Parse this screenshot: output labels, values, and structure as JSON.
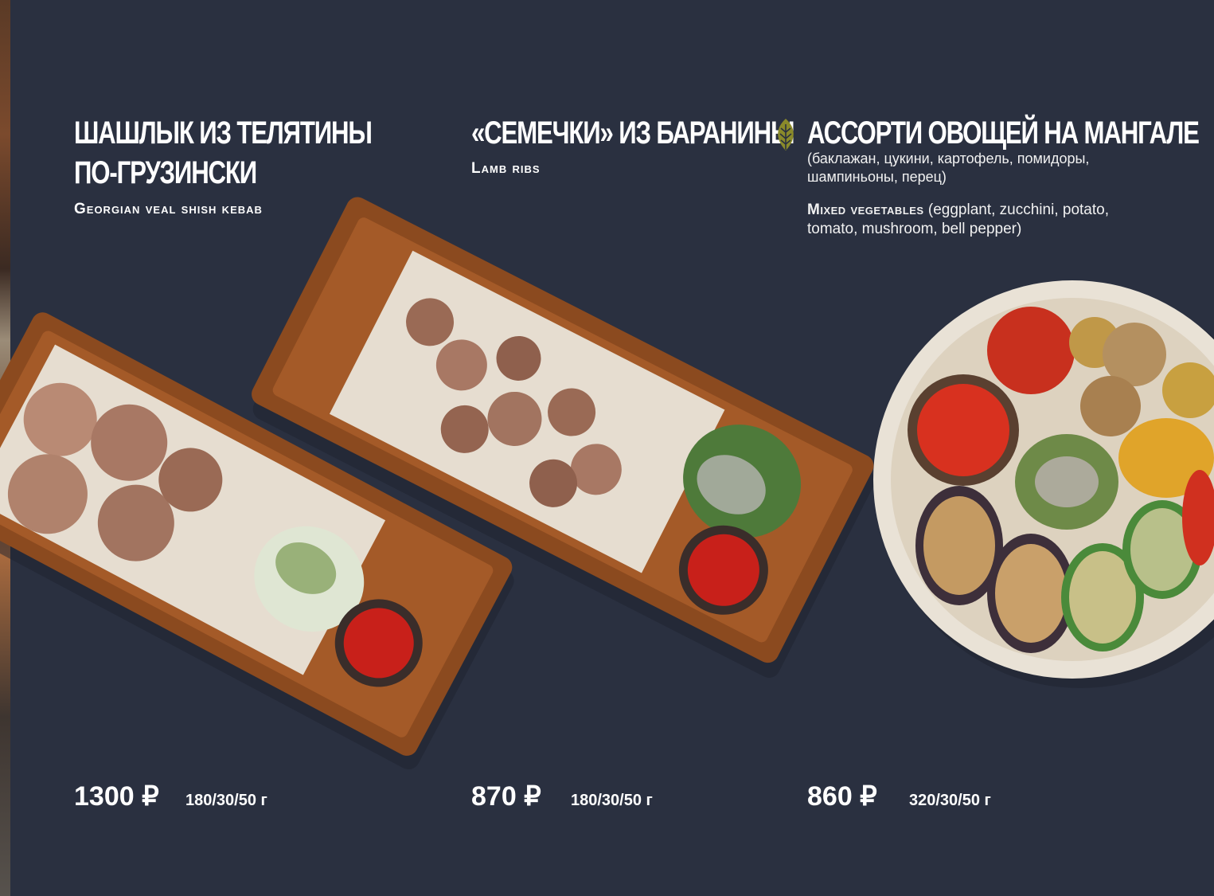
{
  "items": [
    {
      "title_line1": "ШАШЛЫК ИЗ ТЕЛЯТИНЫ",
      "title_line2": "ПО-ГРУЗИНСКИ",
      "name_en": "Georgian veal shish kebab",
      "price": "1300 ₽",
      "weight": "180/30/50 г"
    },
    {
      "title_line1": "«СЕМЕЧКИ» ИЗ БАРАНИНЫ",
      "name_en": "Lamb ribs",
      "price": "870 ₽",
      "weight": "180/30/50 г"
    },
    {
      "title_line1": "АССОРТИ ОВОЩЕЙ НА МАНГАЛЕ",
      "desc_ru": "(баклажан, цукини, картофель, помидоры, шампиньоны, перец)",
      "name_en": "Mixed vegetables",
      "desc_en": "(eggplant, zucchini, potato, tomato, mushroom, bell pepper)",
      "price": "860 ₽",
      "weight": "320/30/50 г",
      "badge_icon": "leaf-icon"
    }
  ],
  "colors": {
    "background": "#2a3040",
    "text": "#ffffff",
    "leaf": "#8a8a2a",
    "board": "#8b4a1f",
    "sauce": "#c8201a"
  }
}
